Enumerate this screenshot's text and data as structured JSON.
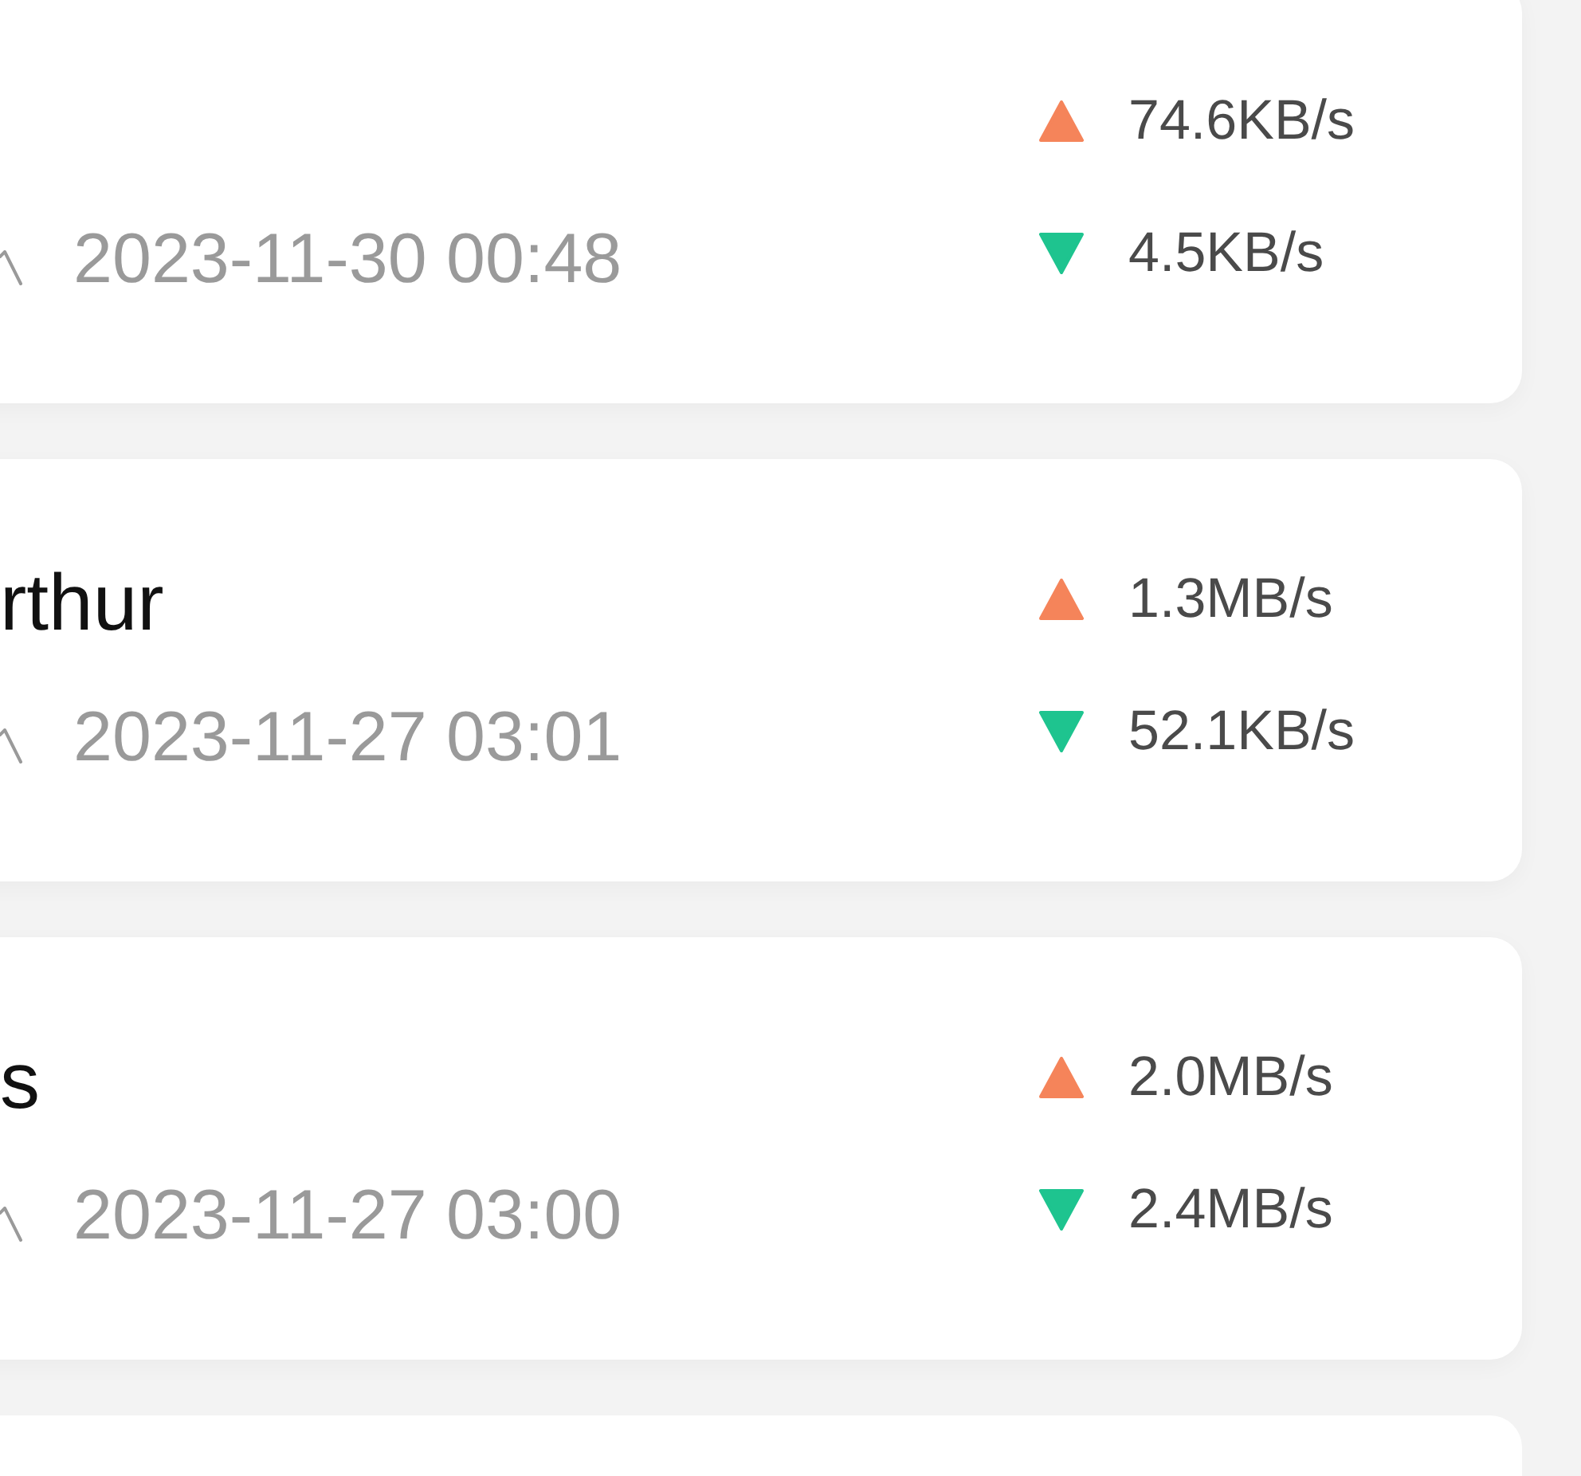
{
  "connections": [
    {
      "time": "2023-11-30 00:48",
      "speeds": [
        {
          "kind": "upload",
          "value": "74.6KB/s"
        },
        {
          "kind": "download",
          "value": "4.5KB/s"
        }
      ]
    },
    {
      "name": "rthur",
      "time": "2023-11-27 03:01",
      "speeds": [
        {
          "kind": "upload",
          "value": "1.3MB/s"
        },
        {
          "kind": "download",
          "value": "52.1KB/s"
        }
      ]
    },
    {
      "name": "s",
      "time": "2023-11-27 03:00",
      "speeds": [
        {
          "kind": "upload",
          "value": "2.0MB/s"
        },
        {
          "kind": "download",
          "value": "2.4MB/s"
        }
      ]
    }
  ]
}
